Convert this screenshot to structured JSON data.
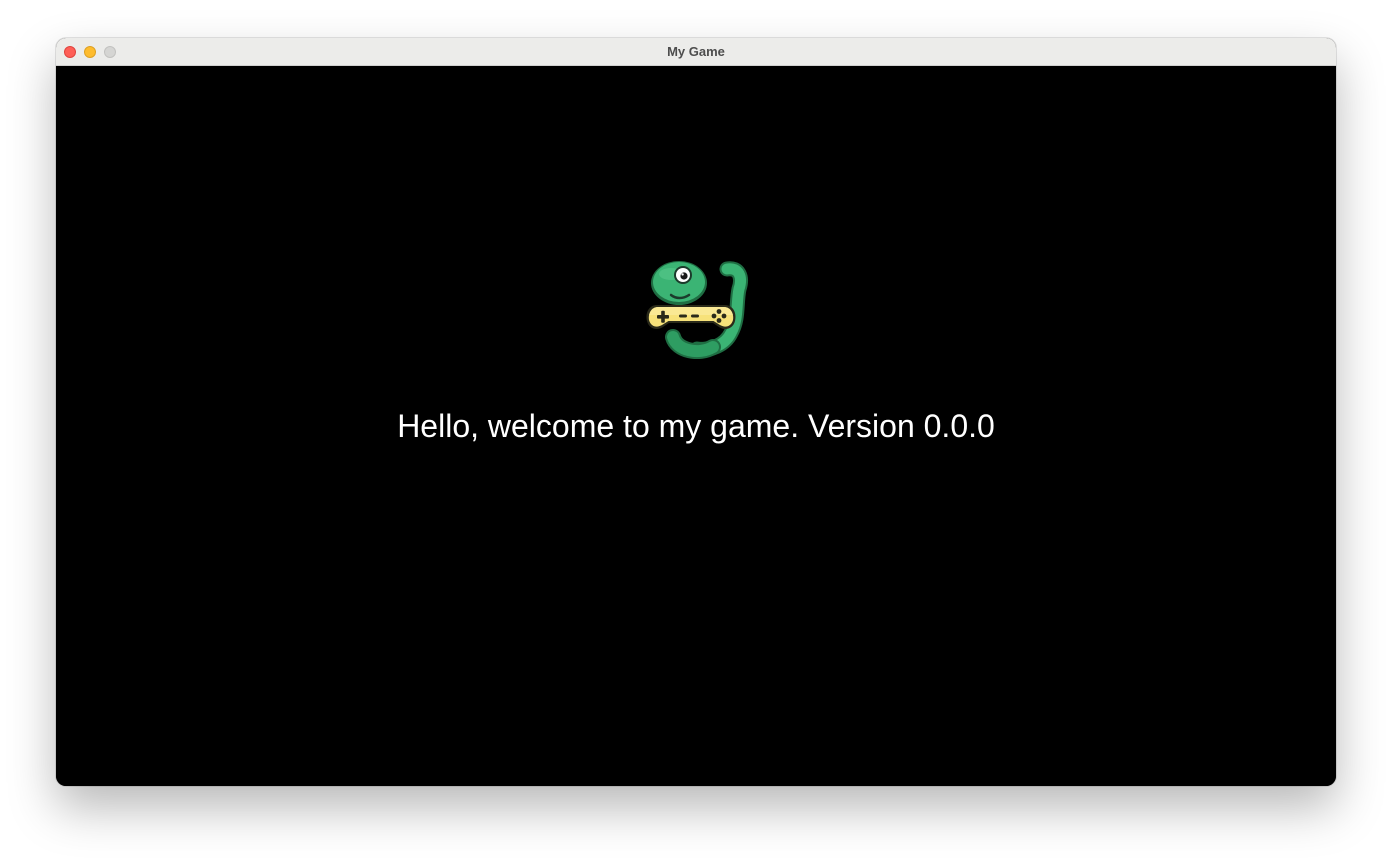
{
  "window": {
    "title": "My Game",
    "controls": {
      "close_color": "#fe5f57",
      "minimize_color": "#febc2e",
      "zoom_color": "#d5d5d3"
    }
  },
  "game": {
    "background_color": "#000000",
    "logo_icon": "python-snake-gamepad-icon",
    "welcome_text": "Hello, welcome to my game. Version 0.0.0",
    "text_color": "#ffffff"
  }
}
